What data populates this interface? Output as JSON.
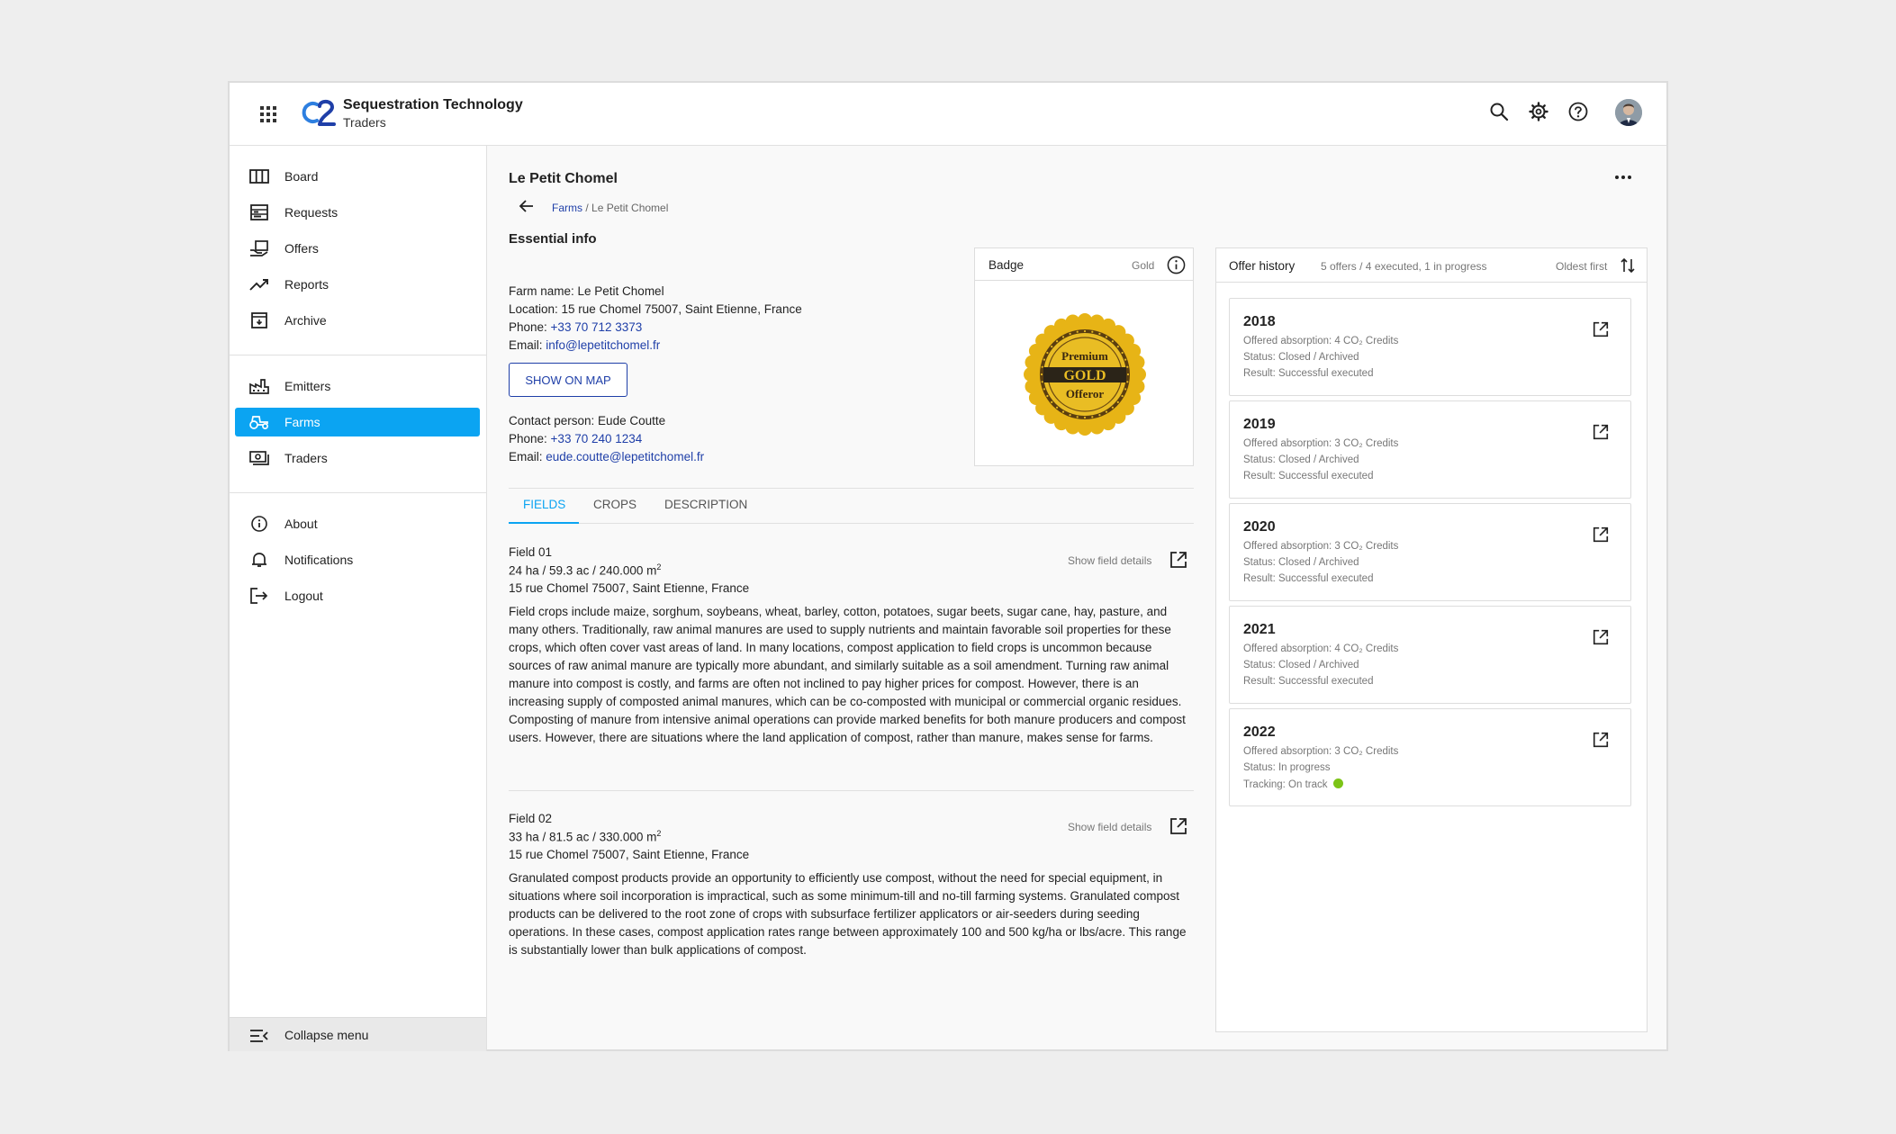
{
  "brand": {
    "name": "Sequestration Technology",
    "subtitle": "Traders"
  },
  "topbar_icons": [
    "search-icon",
    "gear-icon",
    "help-icon",
    "avatar"
  ],
  "sidebar": {
    "items": [
      {
        "label": "Board",
        "icon": "board-icon"
      },
      {
        "label": "Requests",
        "icon": "requests-icon"
      },
      {
        "label": "Offers",
        "icon": "offers-icon"
      },
      {
        "label": "Reports",
        "icon": "trend-icon"
      },
      {
        "label": "Archive",
        "icon": "archive-icon"
      },
      {
        "label": "Emitters",
        "icon": "factory-icon"
      },
      {
        "label": "Farms",
        "icon": "tractor-icon",
        "active": true
      },
      {
        "label": "Traders",
        "icon": "money-icon"
      },
      {
        "label": "About",
        "icon": "info-icon"
      },
      {
        "label": "Notifications",
        "icon": "bell-icon"
      },
      {
        "label": "Logout",
        "icon": "logout-icon"
      }
    ],
    "collapse_label": "Collapse menu"
  },
  "page": {
    "title": "Le Petit Chomel",
    "breadcrumb": {
      "link": "Farms",
      "separator": " / ",
      "current": "Le Petit Chomel"
    }
  },
  "essential": {
    "title": "Essential info",
    "farm_name": "Farm name: Le Petit Chomel",
    "location": "Location: 15 rue Chomel 75007, Saint Etienne, France",
    "phone_label": "Phone: ",
    "phone": "+33 70 712 3373",
    "email_label": "Email: ",
    "email": "info@lepetitchomel.fr",
    "map_button": "SHOW ON MAP",
    "contact": "Contact person: Eude Coutte",
    "contact_phone_label": "Phone: ",
    "contact_phone": "+33 70 240 1234",
    "contact_email_label": "Email: ",
    "contact_email": "eude.coutte@lepetitchomel.fr"
  },
  "badge": {
    "title": "Badge",
    "value": "Gold",
    "seal_top": "Premium",
    "seal_mid": "GOLD",
    "seal_bottom": "Offeror"
  },
  "tabs": [
    {
      "label": "FIELDS",
      "active": true
    },
    {
      "label": "CROPS"
    },
    {
      "label": "DESCRIPTION"
    }
  ],
  "fields": [
    {
      "name": "Field 01",
      "area": "24 ha / 59.3 ac / 240.000 m",
      "address": "15 rue Chomel 75007, Saint Etienne, France",
      "details_label": "Show field details",
      "description": "Field crops include maize, sorghum, soybeans, wheat, barley, cotton, potatoes, sugar beets, sugar cane, hay, pasture, and many others. Traditionally, raw animal manures are used to supply nutrients and maintain favorable soil properties for these crops, which often cover vast areas of land. In many locations, compost application to field crops is uncommon because sources of raw animal manure are typically more abundant, and similarly suitable as a soil amendment. Turning raw animal manure into compost is costly, and farms are often not inclined to pay higher prices for compost. However, there is an increasing supply of composted animal manures, which can be co-composted with municipal or commercial organic residues. Composting of manure from intensive animal operations can provide marked benefits for both manure producers and compost users. However, there are situations where the land application of compost, rather than manure, makes sense for farms."
    },
    {
      "name": "Field 02",
      "area": "33 ha / 81.5 ac / 330.000 m",
      "address": "15 rue Chomel 75007, Saint Etienne, France",
      "details_label": "Show field details",
      "description": "Granulated compost products provide an opportunity to efficiently use compost, without the need for special equipment, in situations where soil incorporation is impractical, such as some minimum-till and no-till farming systems. Granulated compost products can be delivered to the root zone of crops with subsurface fertilizer applicators or air-seeders during seeding operations. In these cases, compost application rates range between approximately 100 and 500 kg/ha or lbs/acre. This range is substantially lower than bulk applications of compost."
    }
  ],
  "area_unit_sup": "2",
  "offer_history": {
    "title": "Offer history",
    "summary": "5 offers / 4 executed, 1 in progress",
    "sort_label": "Oldest first",
    "offers": [
      {
        "year": "2018",
        "absorption": "Offered absorption: 4 CO₂ Credits",
        "status": "Status: Closed / Archived",
        "result": "Result: Successful executed"
      },
      {
        "year": "2019",
        "absorption": "Offered absorption: 3 CO₂ Credits",
        "status": "Status: Closed / Archived",
        "result": "Result: Successful executed"
      },
      {
        "year": "2020",
        "absorption": "Offered absorption: 3 CO₂ Credits",
        "status": "Status: Closed / Archived",
        "result": "Result: Successful executed"
      },
      {
        "year": "2021",
        "absorption": "Offered absorption: 4 CO₂ Credits",
        "status": "Status: Closed / Archived",
        "result": "Result: Successful executed"
      },
      {
        "year": "2022",
        "absorption": "Offered absorption: 3 CO₂ Credits",
        "status": "Status: In progress",
        "result": "Tracking: On track",
        "tracking_color": "#7cc417"
      }
    ]
  },
  "colors": {
    "accent": "#0ba4f2",
    "link": "#1f3fa8",
    "gold": "#e7b416",
    "on_track": "#7cc417"
  }
}
